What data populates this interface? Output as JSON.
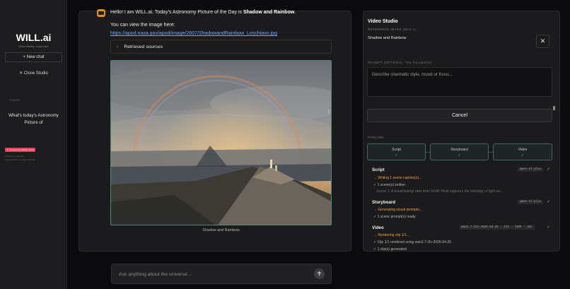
{
  "sidebar": {
    "brand": "WILL.ai",
    "tagline": "What Infinity Looks Like",
    "new_chat_label": "+ New chat",
    "close_studio_label": "✕ Close Studio",
    "section_label": "TODAY",
    "history": [
      {
        "label": "What's today's Astronomy Picture of"
      }
    ],
    "powered_badge": "⚡ Powered by Affinite Cloud",
    "footer_line1": "Astronomy assistant",
    "footer_line2": "Generated by A.I. Apex & Studio"
  },
  "chat": {
    "greeting_pre": "Hello! I am WILL.ai. Today's Astronomy Picture of the Day is ",
    "greeting_bold": "Shadow and Rainbow",
    "greeting_post": ".",
    "view_text": "You can view the image here:",
    "image_link": "https://apod.nasa.gov/apod/image/2607/ShadowandRainbow_Loschiavo.jpg",
    "sources_label": "Retrieved sources",
    "image_caption": "Shadow and Rainbow",
    "input_placeholder": "Ask anything about the universe..."
  },
  "studio": {
    "title": "Video Studio",
    "reference_label": "REFERENCE IMAGE (MAX 1)",
    "reference_name": "Shadow and Rainbow",
    "prompt_label": "PROMPT (OPTIONAL, T2V FALLBACK)",
    "prompt_placeholder": "Describe cinematic style, mood or focus...",
    "cancel_label": "Cancel",
    "pipeline_label": "PIPELINE",
    "pipeline": [
      {
        "name": "Script",
        "check": "✓"
      },
      {
        "name": "Storyboard",
        "check": "✓"
      },
      {
        "name": "Video",
        "check": "✓"
      }
    ],
    "steps": {
      "script": {
        "title": "Script",
        "model": "qwen-vl-plus",
        "check": "✓",
        "log1": "→ Writing 1 scene caption(s)...",
        "log2": "✓ 1 scene(s) written",
        "log3": "Scene 1: A breathtaking view from Smith Peak captures the interplay of light an..."
      },
      "storyboard": {
        "title": "Storyboard",
        "model": "qwen-vl-plus",
        "check": "✓",
        "log1": "→ Generating visual prompts...",
        "log2": "✓ 1 scene prompt(s) ready"
      },
      "video": {
        "title": "Video",
        "model": "wan2.7-i2v-2026-04-25 · I2V · 720P · 10s",
        "check": "✓",
        "log1": "→ Rendering clip 1/1...",
        "log2": "✓ Clip 1/1 rendered using wan2.7-i2v-2026-04-25",
        "log3": "✓ 1 clip(s) generated"
      }
    }
  }
}
